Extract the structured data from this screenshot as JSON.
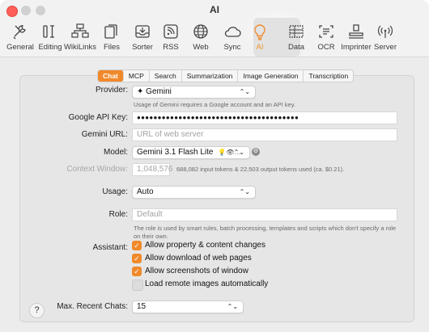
{
  "window": {
    "title": "AI"
  },
  "toolbar": [
    {
      "id": "general",
      "label": "General",
      "icon": "tools-icon"
    },
    {
      "id": "editing",
      "label": "Editing",
      "icon": "text-cursor-icon"
    },
    {
      "id": "wikilinks",
      "label": "WikiLinks",
      "icon": "link-nodes-icon"
    },
    {
      "id": "files",
      "label": "Files",
      "icon": "files-icon"
    },
    {
      "id": "sorter",
      "label": "Sorter",
      "icon": "sorter-tray-icon"
    },
    {
      "id": "rss",
      "label": "RSS",
      "icon": "rss-icon"
    },
    {
      "id": "web",
      "label": "Web",
      "icon": "globe-icon"
    },
    {
      "id": "sync",
      "label": "Sync",
      "icon": "cloud-icon"
    },
    {
      "id": "ai",
      "label": "AI",
      "icon": "lightbulb-icon",
      "active": true
    },
    {
      "id": "data",
      "label": "Data",
      "icon": "data-grid-icon"
    },
    {
      "id": "ocr",
      "label": "OCR",
      "icon": "ocr-scan-icon"
    },
    {
      "id": "imprinter",
      "label": "Imprinter",
      "icon": "stamp-icon"
    },
    {
      "id": "server",
      "label": "Server",
      "icon": "broadcast-icon"
    }
  ],
  "tabs": [
    "Chat",
    "MCP",
    "Search",
    "Summarization",
    "Image Generation",
    "Transcription"
  ],
  "active_tab": "Chat",
  "accent_color": "#f0892a",
  "form": {
    "provider": {
      "label": "Provider:",
      "value": "Gemini",
      "note": "Usage of Gemini requires a Google account and an API key."
    },
    "api_key": {
      "label": "Google API Key:",
      "value": "●●●●●●●●●●●●●●●●●●●●●●●●●●●●●●●●●●●●●●●"
    },
    "gemini_url": {
      "label": "Gemini URL:",
      "placeholder": "URL of web server"
    },
    "model": {
      "label": "Model:",
      "value": "Gemini 3.1 Flash Lite",
      "caps": "💡👁…"
    },
    "context_window": {
      "label": "Context Window:",
      "value": "1,048,576",
      "note": "688,082 input tokens & 22,503 output tokens used (ca. $0.21)."
    },
    "usage": {
      "label": "Usage:",
      "value": "Auto"
    },
    "role": {
      "label": "Role:",
      "placeholder": "Default",
      "note": "The role is used by smart rules, batch processing, templates and scripts which don't specify a role on their own."
    },
    "assistant": {
      "label": "Assistant:",
      "options": [
        {
          "label": "Allow property & content changes",
          "checked": true
        },
        {
          "label": "Allow download of web pages",
          "checked": true
        },
        {
          "label": "Allow screenshots of window",
          "checked": true
        },
        {
          "label": "Load remote images automatically",
          "checked": false
        }
      ]
    },
    "max_recent_chats": {
      "label": "Max. Recent Chats:",
      "value": "15"
    }
  },
  "help": "?"
}
